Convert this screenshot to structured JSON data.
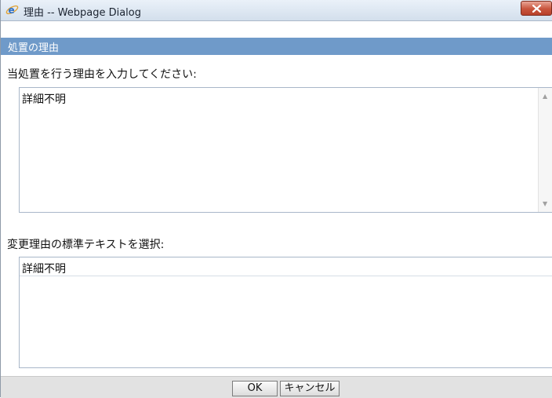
{
  "window": {
    "title": "理由 -- Webpage Dialog"
  },
  "header": {
    "title": "処置の理由"
  },
  "reason": {
    "prompt": "当処置を行う理由を入力してください:",
    "value": "詳細不明"
  },
  "standard_text": {
    "prompt": "変更理由の標準テキストを選択:",
    "options": [
      "詳細不明"
    ]
  },
  "buttons": {
    "ok": "OK",
    "cancel": "キャンセル"
  },
  "colors": {
    "header_bg": "#6f9ac9",
    "close_red": "#c8553d"
  }
}
